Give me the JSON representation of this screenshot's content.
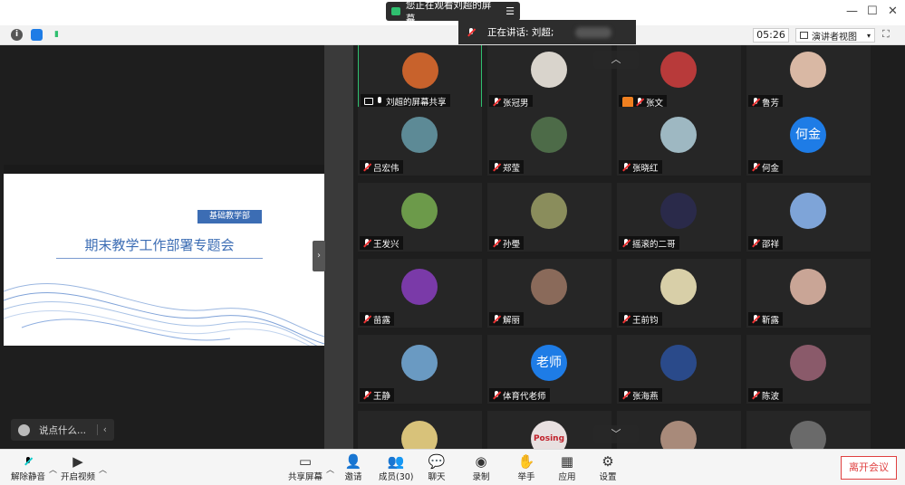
{
  "topbar": {
    "viewing_text": "您正在观看刘超的屏幕",
    "menu_glyph": "☰",
    "speaking_label": "正在讲话: 刘超;",
    "minimize": "—",
    "maximize": "☐",
    "close": "✕"
  },
  "infobar": {
    "timer": "05:26",
    "view_mode": "演讲者视图",
    "info_glyph": "i"
  },
  "slide": {
    "department": "基础教学部",
    "title": "期末教学工作部署专题会"
  },
  "chat": {
    "placeholder": "说点什么...",
    "arrow": "‹"
  },
  "grid": {
    "participants": [
      {
        "name": "刘超的屏幕共享",
        "avatar_color": "#c8622c",
        "avatar_text": "",
        "kind": "screen",
        "active": true
      },
      {
        "name": "张冠男",
        "avatar_color": "#d9d4cc",
        "avatar_text": "",
        "kind": "muted"
      },
      {
        "name": "张文",
        "avatar_color": "#b83a3a",
        "avatar_text": "",
        "kind": "orange"
      },
      {
        "name": "鲁芳",
        "avatar_color": "#d9b8a4",
        "avatar_text": "",
        "kind": "muted"
      },
      {
        "name": "吕宏伟",
        "avatar_color": "#5d8a96",
        "avatar_text": "",
        "kind": "muted"
      },
      {
        "name": "郑莹",
        "avatar_color": "#4d6b48",
        "avatar_text": "",
        "kind": "muted"
      },
      {
        "name": "张晓红",
        "avatar_color": "#9eb8c2",
        "avatar_text": "",
        "kind": "muted"
      },
      {
        "name": "何金",
        "avatar_color": "#1e7ce6",
        "avatar_text": "何金",
        "kind": "muted"
      },
      {
        "name": "王发兴",
        "avatar_color": "#6c9a4a",
        "avatar_text": "",
        "kind": "muted"
      },
      {
        "name": "孙璺",
        "avatar_color": "#8a8d5c",
        "avatar_text": "",
        "kind": "muted"
      },
      {
        "name": "摇滚的二哥",
        "avatar_color": "#2a2a4a",
        "avatar_text": "",
        "kind": "muted"
      },
      {
        "name": "邵祥",
        "avatar_color": "#7ea4d8",
        "avatar_text": "",
        "kind": "muted"
      },
      {
        "name": "苗露",
        "avatar_color": "#7a3aa8",
        "avatar_text": "",
        "kind": "muted"
      },
      {
        "name": "解丽",
        "avatar_color": "#8a6a5a",
        "avatar_text": "",
        "kind": "muted"
      },
      {
        "name": "王前钧",
        "avatar_color": "#d8cfa8",
        "avatar_text": "",
        "kind": "muted"
      },
      {
        "name": "靳露",
        "avatar_color": "#c9a596",
        "avatar_text": "",
        "kind": "muted"
      },
      {
        "name": "王静",
        "avatar_color": "#6a9ac2",
        "avatar_text": "",
        "kind": "muted"
      },
      {
        "name": "体育代老师",
        "avatar_color": "#1e7ce6",
        "avatar_text": "老师",
        "kind": "muted"
      },
      {
        "name": "张海燕",
        "avatar_color": "#2a4a8a",
        "avatar_text": "",
        "kind": "muted"
      },
      {
        "name": "陈波",
        "avatar_color": "#8a5a6a",
        "avatar_text": "",
        "kind": "muted"
      },
      {
        "name": "",
        "avatar_color": "#d8c27a",
        "avatar_text": "",
        "kind": "none"
      },
      {
        "name": "",
        "avatar_color": "#e8e0e0",
        "avatar_text": "Posing",
        "kind": "none"
      },
      {
        "name": "",
        "avatar_color": "#a88a7a",
        "avatar_text": "",
        "kind": "none"
      },
      {
        "name": "",
        "avatar_color": "#6a6a6a",
        "avatar_text": "",
        "kind": "none"
      }
    ]
  },
  "toolbar": {
    "unmute": "解除静音",
    "start_video": "开启视频",
    "share_screen": "共享屏幕",
    "invite": "邀请",
    "members": "成员(30)",
    "chat": "聊天",
    "record": "录制",
    "raise_hand": "举手",
    "apps": "应用",
    "settings": "设置",
    "leave": "离开会议"
  },
  "colors": {
    "accent_green": "#2fbf6f",
    "avatar_blue": "#1e7ce6",
    "leave_red": "#e04040",
    "slide_blue": "#3c6db4"
  }
}
